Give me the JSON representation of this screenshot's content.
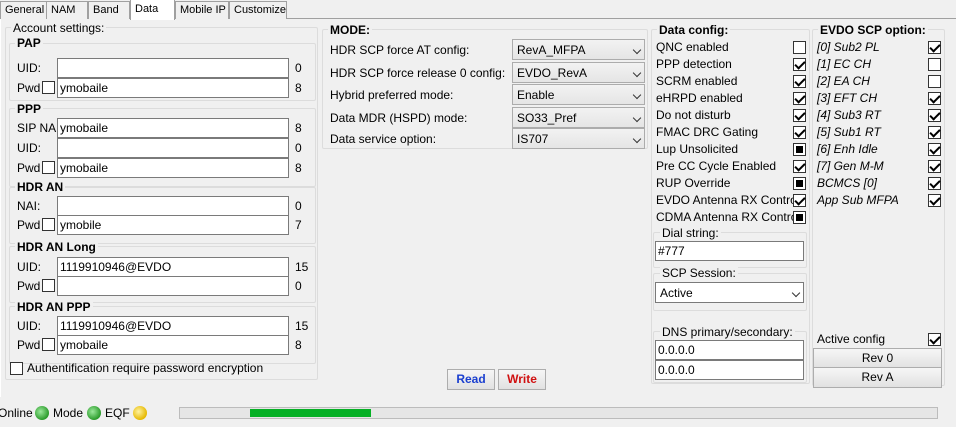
{
  "tabs": [
    "General",
    "NAM",
    "Band",
    "Data",
    "Mobile IP",
    "Customize"
  ],
  "account": {
    "legend": "Account settings:",
    "pap": {
      "title": "PAP",
      "uid_label": "UID:",
      "uid_value": "",
      "uid_count": "0",
      "pwd_label": "Pwd",
      "pwd_value": "ymobaile",
      "pwd_count": "8"
    },
    "ppp": {
      "title": "PPP",
      "sipnai_label": "SIP NAI",
      "sipnai_value": "ymobaile",
      "sipnai_count": "8",
      "uid_label": "UID:",
      "uid_value": "",
      "uid_count": "0",
      "pwd_label": "Pwd",
      "pwd_value": "ymobaile",
      "pwd_count": "8"
    },
    "hdr_an": {
      "title": "HDR AN",
      "nai_label": "NAI:",
      "nai_value": "",
      "nai_count": "0",
      "pwd_label": "Pwd",
      "pwd_value": "ymobile",
      "pwd_count": "7"
    },
    "hdr_an_long": {
      "title": "HDR AN Long",
      "uid_label": "UID:",
      "uid_value": "1119910946@EVDO",
      "uid_count": "15",
      "pwd_label": "Pwd",
      "pwd_value": "",
      "pwd_count": "0"
    },
    "hdr_an_ppp": {
      "title": "HDR AN PPP",
      "uid_label": "UID:",
      "uid_value": "1119910946@EVDO",
      "uid_count": "15",
      "pwd_label": "Pwd",
      "pwd_value": "ymobaile",
      "pwd_count": "8"
    },
    "auth_encrypt_label": "Authentification require password encryption"
  },
  "mode": {
    "legend": "MODE:",
    "rows": [
      {
        "label": "HDR SCP force AT config:",
        "value": "RevA_MFPA"
      },
      {
        "label": "HDR SCP force release 0 config:",
        "value": "EVDO_RevA"
      },
      {
        "label": "Hybrid preferred mode:",
        "value": "Enable"
      },
      {
        "label": "Data MDR (HSPD) mode:",
        "value": "SO33_Pref"
      },
      {
        "label": "Data service option:",
        "value": "IS707"
      }
    ],
    "read_label": "Read",
    "write_label": "Write"
  },
  "data_config": {
    "legend": "Data config:",
    "items": [
      {
        "label": "QNC enabled",
        "state": "off"
      },
      {
        "label": "PPP detection",
        "state": "on"
      },
      {
        "label": "SCRM enabled",
        "state": "on"
      },
      {
        "label": "eHRPD enabled",
        "state": "on"
      },
      {
        "label": "Do not disturb",
        "state": "on"
      },
      {
        "label": "FMAC DRC Gating",
        "state": "on"
      },
      {
        "label": "Lup Unsolicited",
        "state": "indeterminate"
      },
      {
        "label": "Pre CC Cycle Enabled",
        "state": "on"
      },
      {
        "label": "RUP Override",
        "state": "indeterminate"
      },
      {
        "label": "EVDO Antenna RX Control",
        "state": "on"
      },
      {
        "label": "CDMA Antenna RX Control",
        "state": "indeterminate"
      }
    ],
    "dial_legend": "Dial string:",
    "dial_value": "#777",
    "scp_legend": "SCP Session:",
    "scp_value": "Active",
    "dns_legend": "DNS primary/secondary:",
    "dns_primary": "0.0.0.0",
    "dns_secondary": "0.0.0.0"
  },
  "evdo": {
    "legend": "EVDO SCP option:",
    "items": [
      {
        "label": "[0] Sub2 PL",
        "state": "on"
      },
      {
        "label": "[1] EC CH",
        "state": "off"
      },
      {
        "label": "[2] EA CH",
        "state": "off"
      },
      {
        "label": "[3] EFT CH",
        "state": "on"
      },
      {
        "label": "[4] Sub3 RT",
        "state": "on"
      },
      {
        "label": "[5] Sub1 RT",
        "state": "on"
      },
      {
        "label": "[6] Enh Idle",
        "state": "on"
      },
      {
        "label": "[7] Gen M-M",
        "state": "on"
      },
      {
        "label": "BCMCS [0]",
        "state": "on"
      },
      {
        "label": "App Sub MFPA",
        "state": "on"
      }
    ],
    "active_config_label": "Active config",
    "rev0_label": "Rev 0",
    "reva_label": "Rev A"
  },
  "status": {
    "online_label": "Online",
    "mode_label": "Mode",
    "eqf_label": "EQF",
    "progress_percent": 16
  }
}
